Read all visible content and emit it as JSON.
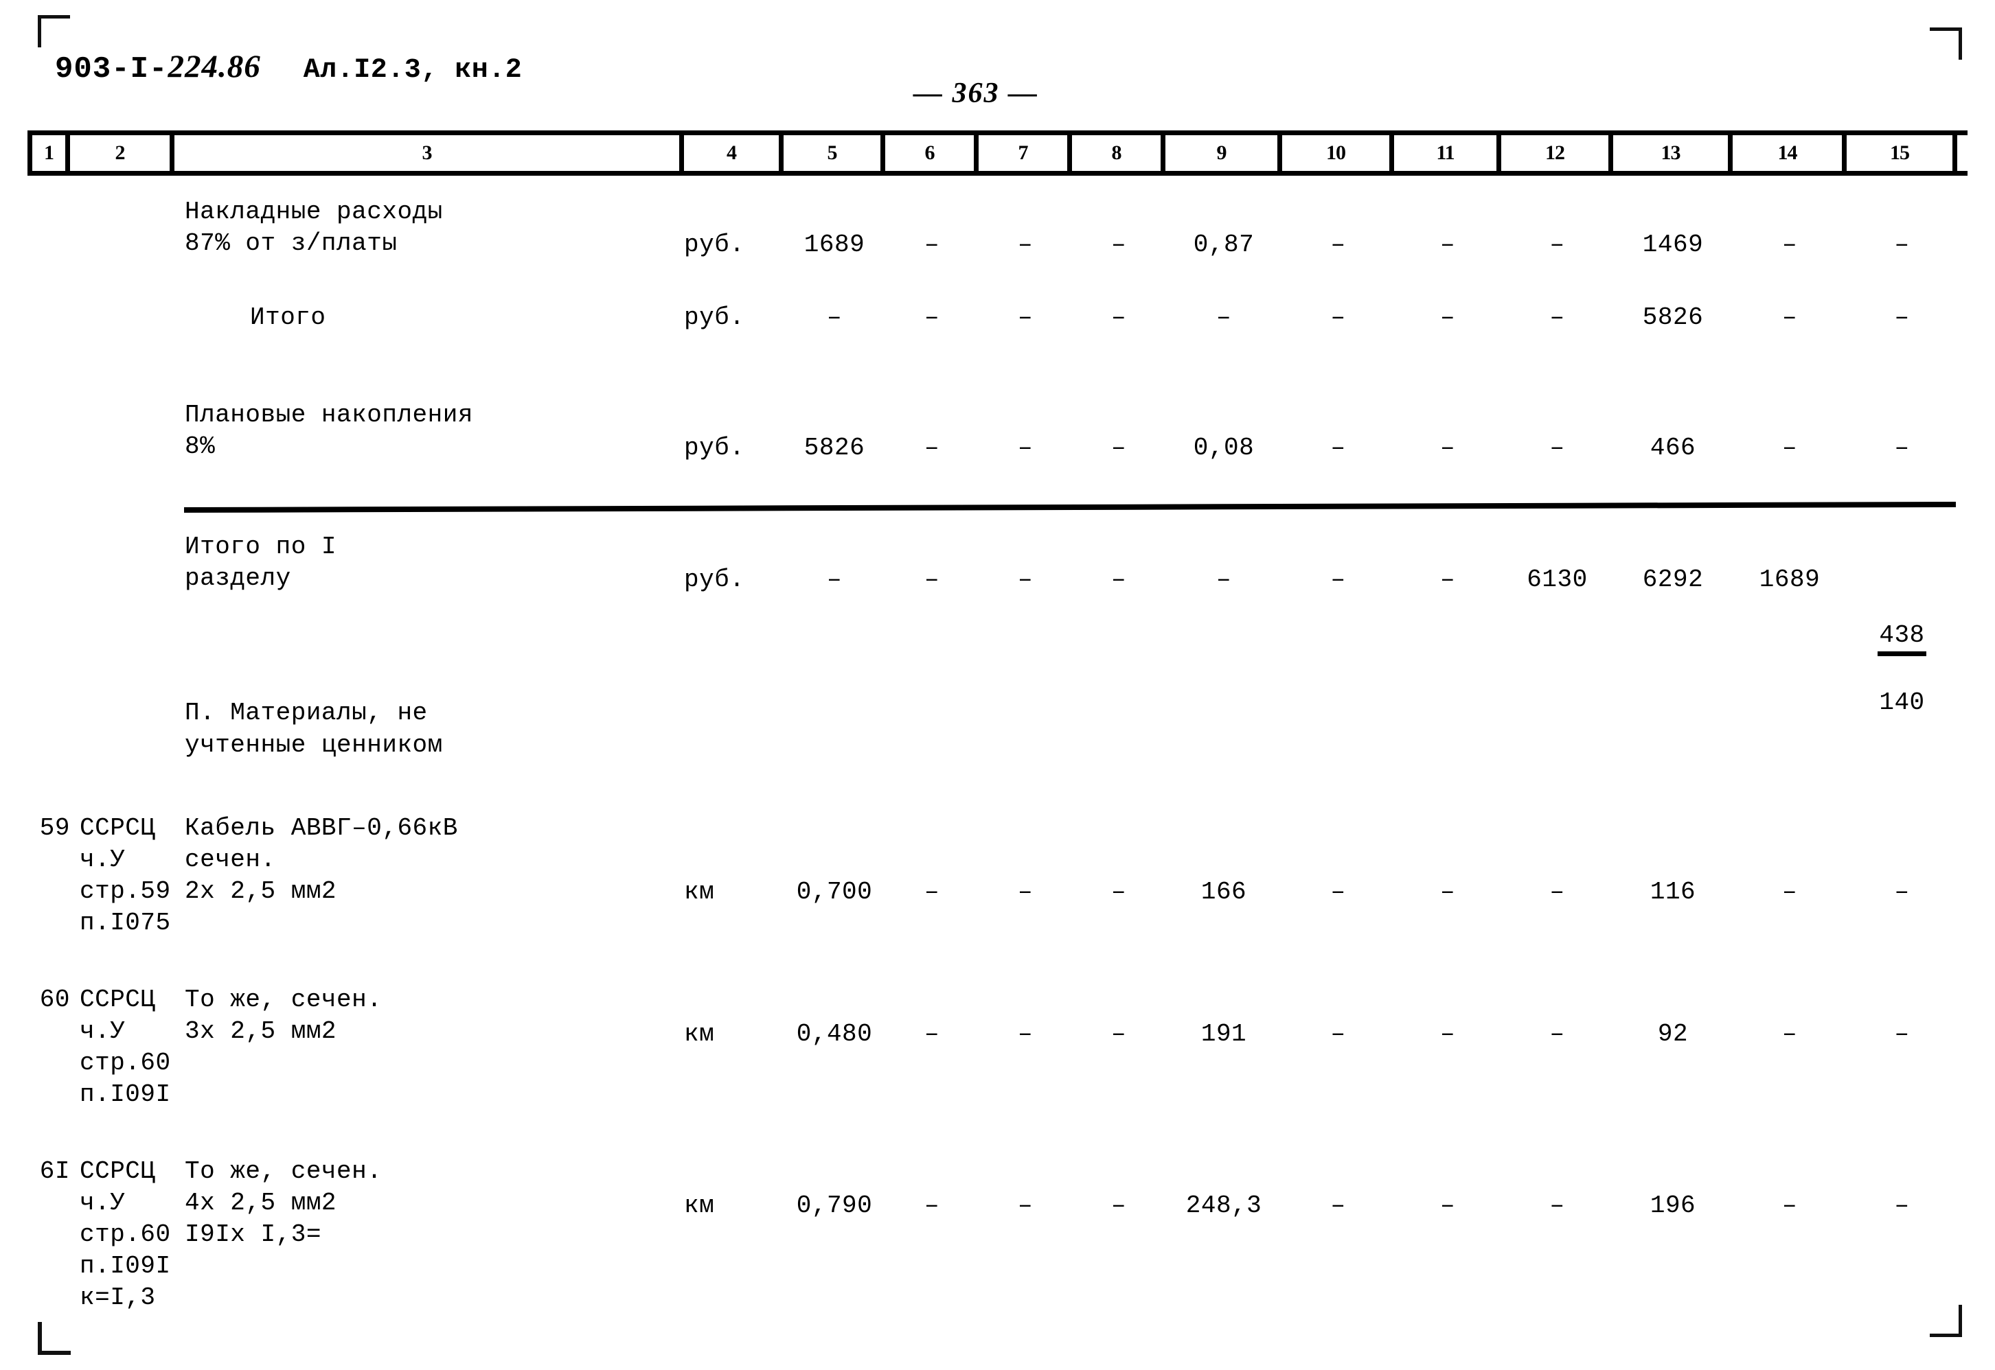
{
  "header": {
    "project_code": "903-I-",
    "project_code_hand": "224.86",
    "album": "Ал.I2.3, кн.2",
    "page_number": "— 363 —"
  },
  "table": {
    "column_numbers": [
      "1",
      "2",
      "3",
      "4",
      "5",
      "6",
      "7",
      "8",
      "9",
      "10",
      "11",
      "12",
      "13",
      "14",
      "15"
    ],
    "dash": "–",
    "rows": [
      {
        "name": "overhead-costs",
        "c1": "",
        "c2": "",
        "c3": "Накладные расходы\n87% от з/платы",
        "c4": "руб.",
        "c5": "1689",
        "c6": "–",
        "c7": "–",
        "c8": "–",
        "c9": "0,87",
        "c10": "–",
        "c11": "–",
        "c12": "–",
        "c13": "1469",
        "c14": "–",
        "c15": "–"
      },
      {
        "name": "subtotal",
        "c1": "",
        "c2": "",
        "c3": "Итого",
        "c4": "руб.",
        "c5": "–",
        "c6": "–",
        "c7": "–",
        "c8": "–",
        "c9": "–",
        "c10": "–",
        "c11": "–",
        "c12": "–",
        "c13": "5826",
        "c14": "–",
        "c15": "–"
      },
      {
        "name": "planned-savings",
        "c1": "",
        "c2": "",
        "c3": "Плановые накопления\n8%",
        "c4": "руб.",
        "c5": "5826",
        "c6": "–",
        "c7": "–",
        "c8": "–",
        "c9": "0,08",
        "c10": "–",
        "c11": "–",
        "c12": "–",
        "c13": "466",
        "c14": "–",
        "c15": "–"
      },
      {
        "name": "section-one-total",
        "c1": "",
        "c2": "",
        "c3": "Итого по I\nразделу",
        "c4": "руб.",
        "c5": "–",
        "c6": "–",
        "c7": "–",
        "c8": "–",
        "c9": "–",
        "c10": "–",
        "c11": "–",
        "c12": "6130",
        "c13": "6292",
        "c14": "1689",
        "c15_numerator": "438",
        "c15_denominator": "140"
      },
      {
        "name": "cable-avvg-2x25",
        "c1": "59",
        "c2": "ССРСЦ\nч.У\nстр.59\nп.I075",
        "c3": "Кабель АВВГ–0,66кВ\nсечен.\n        2х 2,5 мм2",
        "c4": "км",
        "c5": "0,700",
        "c6": "–",
        "c7": "–",
        "c8": "–",
        "c9": "166",
        "c10": "–",
        "c11": "–",
        "c12": "–",
        "c13": "116",
        "c14": "–",
        "c15": "–"
      },
      {
        "name": "cable-avvg-3x25",
        "c1": "60",
        "c2": "ССРСЦ\nч.У\nстр.60\nп.I09I",
        "c3": "То же, сечен.\n        3х 2,5 мм2",
        "c4": "км",
        "c5": "0,480",
        "c6": "–",
        "c7": "–",
        "c8": "–",
        "c9": "191",
        "c10": "–",
        "c11": "–",
        "c12": "–",
        "c13": "92",
        "c14": "–",
        "c15": "–"
      },
      {
        "name": "cable-avvg-4x25",
        "c1": "6I",
        "c2": "ССРСЦ\nч.У\nстр.60\nп.I09I\nк=I,3",
        "c3": "То же, сечен.\n        4х 2,5 мм2\n        I9Iх I,3=",
        "c4": "км",
        "c5": "0,790",
        "c6": "–",
        "c7": "–",
        "c8": "–",
        "c9": "248,3",
        "c10": "–",
        "c11": "–",
        "c12": "–",
        "c13": "196",
        "c14": "–",
        "c15": "–"
      }
    ],
    "section_heading": "П. Материалы, не\n    учтенные ценником"
  }
}
